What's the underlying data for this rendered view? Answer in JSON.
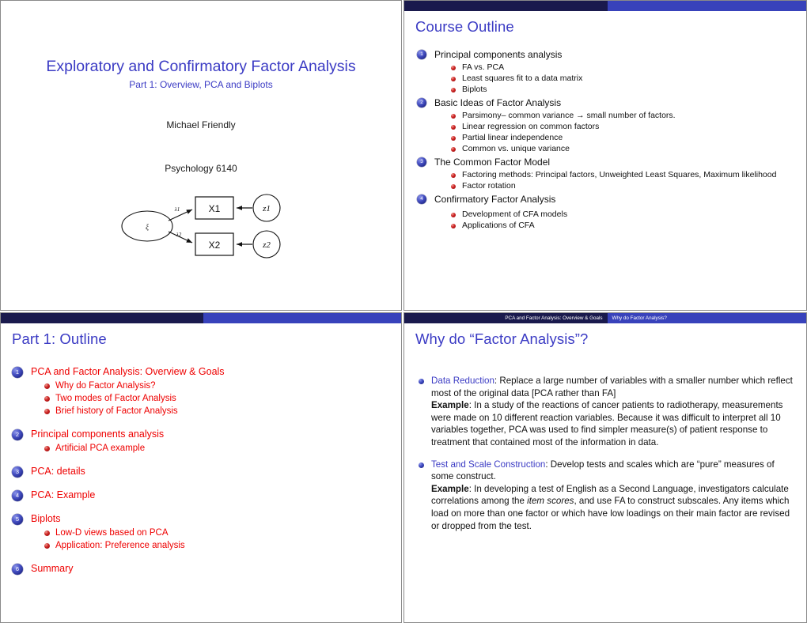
{
  "colors": {
    "title_blue": "#3b3bc4",
    "red": "#ee0000",
    "header_dark": "#1a1a4d",
    "header_bright": "#3842bb"
  },
  "slides": {
    "title_slide": {
      "main_title": "Exploratory and Confirmatory Factor Analysis",
      "subtitle": "Part 1: Overview, PCA and Biplots",
      "author": "Michael Friendly",
      "course": "Psychology 6140",
      "diagram": {
        "factor_label": "ξ",
        "path_label_1": "λ1",
        "path_label_2": "λ2",
        "indicator_1": "X1",
        "indicator_2": "X2",
        "error_1": "z1",
        "error_2": "z2"
      }
    },
    "course_outline": {
      "title": "Course Outline",
      "items": [
        {
          "num": "1",
          "label": "Principal components analysis",
          "subs": [
            "FA vs. PCA",
            "Least squares fit to a data matrix",
            "Biplots"
          ]
        },
        {
          "num": "2",
          "label": "Basic Ideas of Factor Analysis",
          "subs": [
            "Parsimony– common variance → small number of factors.",
            "Linear regression on common factors",
            "Partial linear independence",
            "Common vs. unique variance"
          ]
        },
        {
          "num": "3",
          "label": "The Common Factor Model",
          "subs": [
            "Factoring methods: Principal factors, Unweighted Least Squares, Maximum likelihood",
            "Factor rotation"
          ]
        },
        {
          "num": "4",
          "label": "Confirmatory Factor Analysis",
          "subs": [
            "Development of CFA models",
            "Applications of CFA"
          ]
        }
      ]
    },
    "part1_outline": {
      "title": "Part 1: Outline",
      "items": [
        {
          "num": "1",
          "label": "PCA and Factor Analysis: Overview & Goals",
          "subs": [
            "Why do Factor Analysis?",
            "Two modes of Factor Analysis",
            "Brief history of Factor Analysis"
          ]
        },
        {
          "num": "2",
          "label": "Principal components analysis",
          "subs": [
            "Artificial PCA example"
          ]
        },
        {
          "num": "3",
          "label": "PCA: details",
          "subs": []
        },
        {
          "num": "4",
          "label": "PCA: Example",
          "subs": []
        },
        {
          "num": "5",
          "label": "Biplots",
          "subs": [
            "Low-D views based on PCA",
            "Application: Preference analysis"
          ]
        },
        {
          "num": "6",
          "label": "Summary",
          "subs": []
        }
      ]
    },
    "why_factor_analysis": {
      "header_left": "PCA and Factor Analysis: Overview & Goals",
      "header_right": "Why do Factor Analysis?",
      "title": "Why do “Factor Analysis”?",
      "points": [
        {
          "lead": "Data Reduction",
          "body": ": Replace a large number of variables with a smaller number which reflect most of the original data [PCA rather than FA]",
          "example_label": "Example",
          "example_body": ": In a study of the reactions of cancer patients to radiotherapy, measurements were made on 10 different reaction variables. Because it was difficult to interpret all 10 variables together, PCA was used to find simpler measure(s) of patient response to treatment that contained most of the information in data."
        },
        {
          "lead": "Test and Scale Construction",
          "body": ": Develop tests and scales which are “pure” measures of some construct.",
          "example_label": "Example",
          "example_body_pre": ": In developing a test of English as a Second Language, investigators calculate correlations among the ",
          "example_italic": "item scores",
          "example_body_post": ", and use FA to construct subscales. Any items which load on more than one factor or which have low loadings on their main factor are revised or dropped from the test."
        }
      ]
    }
  }
}
